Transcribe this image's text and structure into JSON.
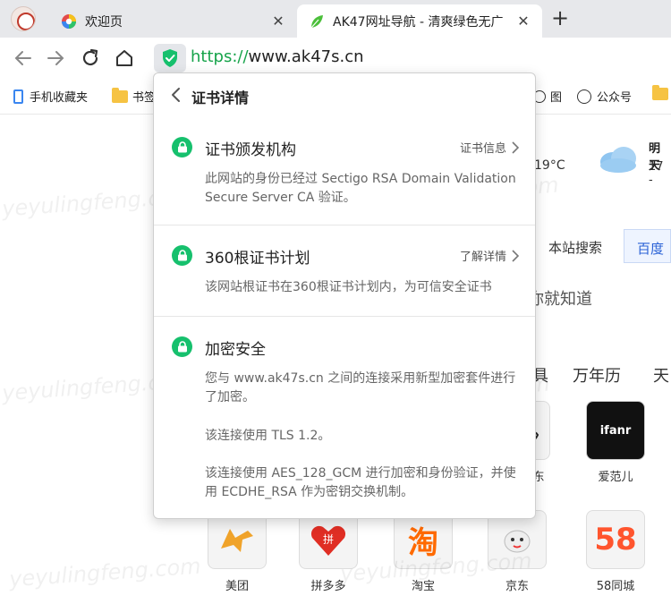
{
  "tabs": [
    {
      "title": "欢迎页",
      "close": "✕"
    },
    {
      "title": "AK47网址导航 - 清爽绿色无广",
      "close": "✕"
    }
  ],
  "new_tab": "+",
  "address": {
    "scheme": "https://",
    "host": "www.ak47s.cn"
  },
  "bookmarks": [
    {
      "label": "手机收藏夹"
    },
    {
      "label": "书签"
    },
    {
      "label": "图"
    },
    {
      "label": "公众号"
    }
  ],
  "page": {
    "weather_temp": "19°C",
    "weather_tomorrow": "明天",
    "weather_tomorrow_temp": "17 -",
    "search_tabs": [
      "本站搜索",
      "百度"
    ],
    "slogan": "你就知道",
    "category_tabs": [
      "具",
      "万年历",
      "天"
    ],
    "sites": [
      "美团",
      "拼多多",
      "淘宝",
      "京东",
      "58同城",
      "爱范儿",
      "东"
    ],
    "ifanr_logo": "ifanr",
    "logo_58": "58",
    "taobao_logo": "淘",
    "pdd_logo": "拼",
    "watermark": "yeyulingfeng.com"
  },
  "popup": {
    "title": "证书详情",
    "sections": [
      {
        "title": "证书颁发机构",
        "link": "证书信息",
        "desc": "此网站的身份已经过 Sectigo RSA Domain Validation Secure Server CA 验证。"
      },
      {
        "title": "360根证书计划",
        "link": "了解详情",
        "desc": "该网站根证书在360根证书计划内，为可信安全证书"
      },
      {
        "title": "加密安全",
        "desc1": "您与 www.ak47s.cn 之间的连接采用新型加密套件进行了加密。",
        "desc2": "该连接使用 TLS 1.2。",
        "desc3": "该连接使用 AES_128_GCM 进行加密和身份验证，并使用 ECDHE_RSA 作为密钥交换机制。"
      }
    ]
  },
  "colors": {
    "accent_green": "#16c06d",
    "url_green": "#16a34a",
    "link_blue": "#2a62d6"
  }
}
